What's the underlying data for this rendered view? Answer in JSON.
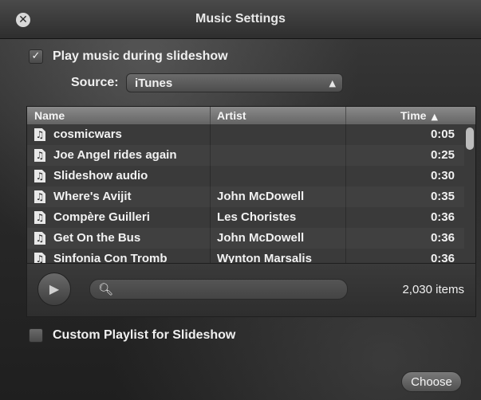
{
  "window": {
    "title": "Music Settings"
  },
  "play_music": {
    "label": "Play music during slideshow",
    "checked": true
  },
  "source": {
    "label": "Source:",
    "selected": "iTunes"
  },
  "table": {
    "columns": [
      "Name",
      "Artist",
      "Time"
    ],
    "sorted_column": "Time",
    "rows": [
      {
        "name": "cosmicwars",
        "artist": "",
        "time": "0:05"
      },
      {
        "name": "Joe Angel rides again",
        "artist": "",
        "time": "0:25"
      },
      {
        "name": "Slideshow audio",
        "artist": "",
        "time": "0:30"
      },
      {
        "name": "Where's Avijit",
        "artist": "John McDowell",
        "time": "0:35"
      },
      {
        "name": "Compère Guilleri",
        "artist": "Les Choristes",
        "time": "0:36"
      },
      {
        "name": "Get On the Bus",
        "artist": "John McDowell",
        "time": "0:36"
      },
      {
        "name": "Sinfonia Con Tromb",
        "artist": "Wynton Marsalis",
        "time": "0:36"
      }
    ]
  },
  "search": {
    "value": "",
    "placeholder": ""
  },
  "item_count": "2,030 items",
  "custom_playlist": {
    "label": "Custom Playlist for Slideshow",
    "checked": false
  },
  "choose_button": {
    "label": "Choose"
  }
}
